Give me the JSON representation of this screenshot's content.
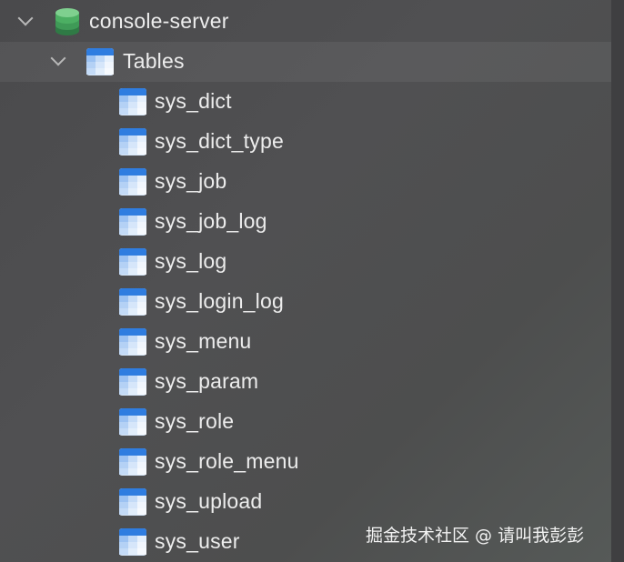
{
  "tree": {
    "database": {
      "label": "console-server",
      "icon": "database-icon",
      "expanded": true
    },
    "folder": {
      "label": "Tables",
      "icon": "table-icon",
      "expanded": true
    },
    "tables": [
      {
        "label": "sys_dict"
      },
      {
        "label": "sys_dict_type"
      },
      {
        "label": "sys_job"
      },
      {
        "label": "sys_job_log"
      },
      {
        "label": "sys_log"
      },
      {
        "label": "sys_login_log"
      },
      {
        "label": "sys_menu"
      },
      {
        "label": "sys_param"
      },
      {
        "label": "sys_role"
      },
      {
        "label": "sys_role_menu"
      },
      {
        "label": "sys_upload"
      },
      {
        "label": "sys_user"
      }
    ]
  },
  "watermark": "掘金技术社区 @ 请叫我彭彭",
  "colors": {
    "background": "#4d4d4f",
    "text": "#ededed",
    "db_green": "#4caf63",
    "table_blue": "#3b86e0"
  }
}
